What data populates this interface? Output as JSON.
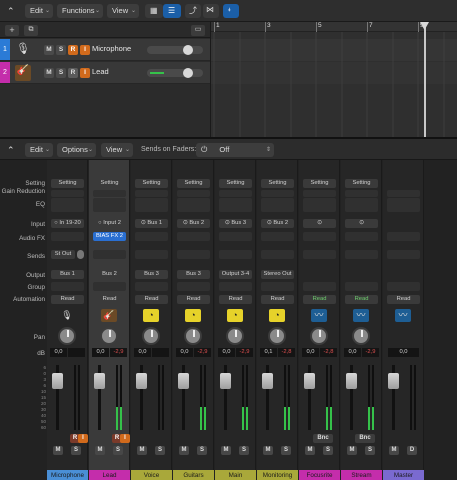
{
  "toolbar": {
    "edit_label": "Edit",
    "functions_label": "Functions",
    "view_label": "View"
  },
  "ruler": {
    "bars": [
      "1",
      "3",
      "5",
      "7",
      "9"
    ]
  },
  "tracks": [
    {
      "number": "1",
      "name": "Microphone",
      "color": "#2b7bd6",
      "m": "M",
      "s": "S",
      "r": "R",
      "i": "I",
      "volume": 0.7
    },
    {
      "number": "2",
      "name": "Lead",
      "color": "#c42dab",
      "m": "M",
      "s": "S",
      "r": "R",
      "i": "I",
      "volume": 0.7
    }
  ],
  "mixer_toolbar": {
    "edit_label": "Edit",
    "options_label": "Options",
    "view_label": "View",
    "sends_on_faders_label": "Sends on Faders:",
    "sends_value": "Off"
  },
  "row_labels": {
    "setting": "Setting",
    "gain_reduction": "Gain Reduction",
    "eq": "EQ",
    "input": "Input",
    "audio_fx": "Audio FX",
    "sends": "Sends",
    "output": "Output",
    "group": "Group",
    "automation": "Automation",
    "pan": "Pan",
    "db": "dB"
  },
  "strips": [
    {
      "name": "Microphone",
      "color": "#4a8fd6",
      "setting": "Setting",
      "input": "In 19-20",
      "audio_fx": "",
      "send": "St Out",
      "output": "Bus 1",
      "automation": "Read",
      "auto_green": false,
      "icon": "microphone-icon",
      "db1": "0,0",
      "db2": "",
      "m": "M",
      "s": "S",
      "r": "R",
      "i": "I",
      "bnc": "",
      "meter": 0.0
    },
    {
      "name": "Lead",
      "color": "#c42dab",
      "setting": "Setting",
      "input": "Input 2",
      "audio_fx": "BIAS FX 2",
      "send": "",
      "output": "Bus 2",
      "automation": "Read",
      "auto_green": false,
      "icon": "guitar-icon",
      "db1": "0,0",
      "db2": "-2,9",
      "m": "M",
      "s": "S",
      "r": "R",
      "i": "I",
      "bnc": "",
      "meter": 0.35
    },
    {
      "name": "Voice",
      "color": "#a9a83a",
      "setting": "Setting",
      "input": "Bus 1",
      "audio_fx": "",
      "send": "",
      "output": "Bus 3",
      "automation": "Read",
      "auto_green": false,
      "icon": "aux-icon",
      "db1": "0,0",
      "db2": "",
      "m": "M",
      "s": "S",
      "r": "",
      "i": "",
      "bnc": "",
      "meter": 0.0
    },
    {
      "name": "Guitars",
      "color": "#a9a83a",
      "setting": "Setting",
      "input": "Bus 2",
      "audio_fx": "",
      "send": "",
      "output": "Bus 3",
      "automation": "Read",
      "auto_green": false,
      "icon": "aux-icon",
      "db1": "0,0",
      "db2": "-2,9",
      "m": "M",
      "s": "S",
      "r": "",
      "i": "",
      "bnc": "",
      "meter": 0.35
    },
    {
      "name": "Main",
      "color": "#a9a83a",
      "setting": "Setting",
      "input": "Bus 3",
      "audio_fx": "",
      "send": "",
      "output": "Output 3-4",
      "automation": "Read",
      "auto_green": false,
      "icon": "aux-icon",
      "db1": "0,0",
      "db2": "-2,9",
      "m": "M",
      "s": "S",
      "r": "",
      "i": "",
      "bnc": "",
      "meter": 0.35
    },
    {
      "name": "Monitoring",
      "color": "#a9a83a",
      "setting": "Setting",
      "input": "Bus 2",
      "audio_fx": "",
      "send": "",
      "output": "Stereo Out",
      "automation": "Read",
      "auto_green": false,
      "icon": "aux-icon",
      "db1": "0,1",
      "db2": "-2,8",
      "m": "M",
      "s": "S",
      "r": "",
      "i": "",
      "bnc": "",
      "meter": 0.35
    },
    {
      "name": "Focusrite",
      "color": "#c42dab",
      "setting": "Setting",
      "input": "",
      "audio_fx": "",
      "send": "",
      "output": "",
      "automation": "Read",
      "auto_green": true,
      "icon": "waveform-icon",
      "db1": "0,0",
      "db2": "-2,8",
      "m": "M",
      "s": "S",
      "r": "",
      "i": "",
      "bnc": "Bnc",
      "meter": 0.35
    },
    {
      "name": "Stream",
      "color": "#c42dab",
      "setting": "Setting",
      "input": "",
      "audio_fx": "",
      "send": "",
      "output": "",
      "automation": "Read",
      "auto_green": true,
      "icon": "waveform-icon",
      "db1": "0,0",
      "db2": "-2,9",
      "m": "M",
      "s": "S",
      "r": "",
      "i": "",
      "bnc": "Bnc",
      "meter": 0.35
    },
    {
      "name": "Master",
      "color": "#7a6ad0",
      "setting": "",
      "input": "",
      "audio_fx": "",
      "send": "",
      "output": "",
      "automation": "Read",
      "auto_green": false,
      "icon": "waveform-icon",
      "db1": "0,0",
      "db2": "",
      "m": "M",
      "s": "",
      "r": "",
      "i": "",
      "bnc": "",
      "d": "D",
      "meter": 0.0
    }
  ],
  "scale_ticks": [
    "6",
    "0",
    "3",
    "6",
    "10",
    "15",
    "20",
    "30",
    "40",
    "50",
    "60"
  ],
  "colors": {
    "accent_blue": "#1b5fa8",
    "record_orange": "#d16a1c",
    "yellow_icon": "#e6d22a",
    "meter_green": "#35c24a"
  }
}
